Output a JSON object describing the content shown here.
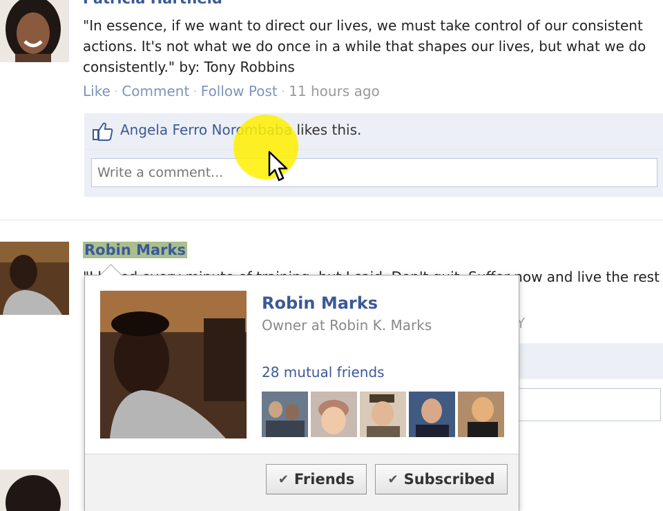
{
  "post1": {
    "author": "Patricia Hartfield",
    "text": "\"In essence, if we want to direct our lives, we must take control of our consistent actions. It's not what we do once in a while that shapes our lives, but what we do consistently.\" by: Tony Robbins",
    "actions": {
      "like": "Like",
      "comment": "Comment",
      "follow": "Follow Post",
      "time": "11 hours ago"
    },
    "likes": {
      "liker": "Angela Ferro Norombaba",
      "suffix": " likes this."
    },
    "comment_placeholder": "Write a comment..."
  },
  "post2": {
    "author": "Robin Marks",
    "text_visible": "\"I hated every minute of training, but I said, Don't quit. Suffer now and live the rest",
    "faded_tail": "Y"
  },
  "hovercard": {
    "name": "Robin Marks",
    "job": "Owner at Robin K. Marks",
    "mutual": "28 mutual friends",
    "friends_button": "Friends",
    "subscribed_button": "Subscribed"
  },
  "colors": {
    "link": "#3b5998",
    "likes_bg": "#eceff5",
    "highlight": "#a9bf8d",
    "cursor_highlight": "#fff000"
  }
}
